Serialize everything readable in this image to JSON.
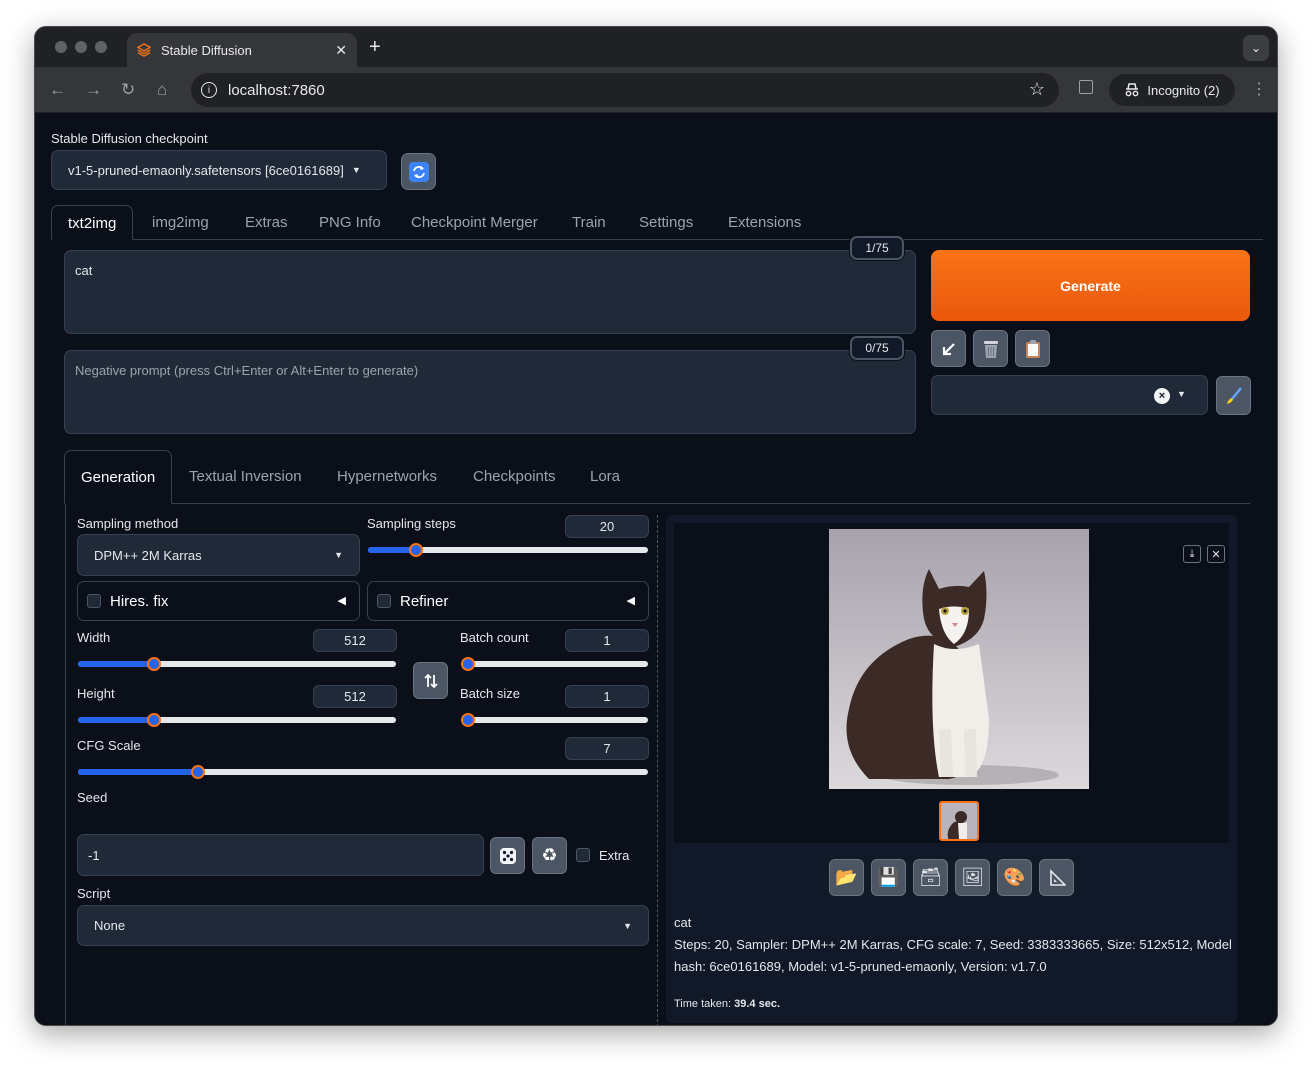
{
  "browser": {
    "tab_title": "Stable Diffusion",
    "url": "localhost:7860",
    "profile": "Incognito (2)",
    "new_tab_glyph": "+",
    "close_tab_glyph": "✕"
  },
  "checkpoint": {
    "label": "Stable Diffusion checkpoint",
    "value": "v1-5-pruned-emaonly.safetensors [6ce0161689]"
  },
  "main_tabs": [
    "txt2img",
    "img2img",
    "Extras",
    "PNG Info",
    "Checkpoint Merger",
    "Train",
    "Settings",
    "Extensions"
  ],
  "prompt": {
    "value": "cat",
    "counter": "1/75"
  },
  "negative_prompt": {
    "placeholder": "Negative prompt (press Ctrl+Enter or Alt+Enter to generate)",
    "counter": "0/75"
  },
  "generate_label": "Generate",
  "sub_tabs": [
    "Generation",
    "Textual Inversion",
    "Hypernetworks",
    "Checkpoints",
    "Lora"
  ],
  "generation": {
    "sampling_method_label": "Sampling method",
    "sampling_method_value": "DPM++ 2M Karras",
    "sampling_steps_label": "Sampling steps",
    "sampling_steps_value": "20",
    "sampling_steps_fraction": 0.17,
    "hires_label": "Hires. fix",
    "refiner_label": "Refiner",
    "width_label": "Width",
    "width_value": "512",
    "width_fraction": 0.24,
    "height_label": "Height",
    "height_value": "512",
    "height_fraction": 0.24,
    "batch_count_label": "Batch count",
    "batch_count_value": "1",
    "batch_count_fraction": 0.0,
    "batch_size_label": "Batch size",
    "batch_size_value": "1",
    "batch_size_fraction": 0.0,
    "cfg_label": "CFG Scale",
    "cfg_value": "7",
    "cfg_fraction": 0.21,
    "seed_label": "Seed",
    "seed_value": "-1",
    "extra_label": "Extra",
    "script_label": "Script",
    "script_value": "None"
  },
  "output": {
    "prompt": "cat",
    "params_line1": "Steps: 20, Sampler: DPM++ 2M Karras, CFG scale: 7, Seed: 3383333665, Size: 512x512, Model",
    "params_line2": "hash: 6ce0161689, Model: v1-5-pruned-emaonly, Version: v1.7.0",
    "time_label": "Time taken:",
    "time_value": "39.4 sec."
  },
  "colors": {
    "accent": "#f97316",
    "slider": "#2563eb",
    "background": "#0b0f19"
  }
}
